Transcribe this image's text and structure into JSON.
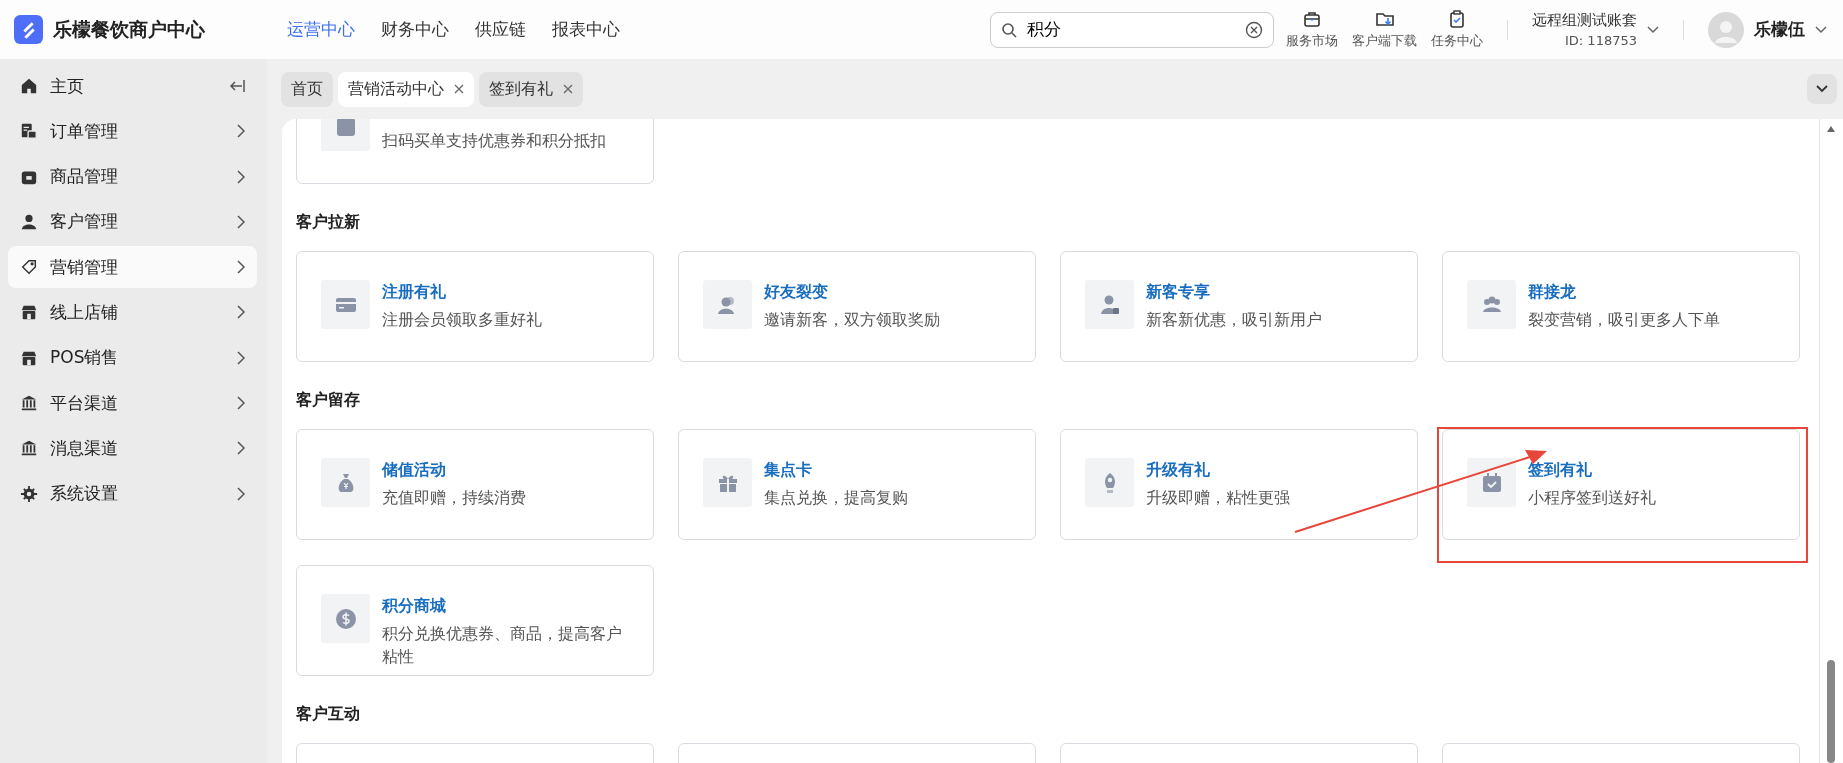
{
  "header": {
    "brand": "乐檬餐饮商户中心",
    "nav": [
      {
        "label": "运营中心",
        "selected": true
      },
      {
        "label": "财务中心",
        "selected": false
      },
      {
        "label": "供应链",
        "selected": false
      },
      {
        "label": "报表中心",
        "selected": false
      }
    ],
    "search": {
      "value": "积分"
    },
    "tools": [
      {
        "label": "服务市场",
        "kind": "bag"
      },
      {
        "label": "客户端下载",
        "kind": "download"
      },
      {
        "label": "任务中心",
        "kind": "task"
      }
    ],
    "account": {
      "name": "远程组测试账套",
      "id": "ID: 118753"
    },
    "user": {
      "name": "乐檬伍"
    }
  },
  "sidebar": {
    "items": [
      {
        "label": "主页",
        "kind": "home",
        "selected": false
      },
      {
        "label": "订单管理",
        "kind": "order",
        "selected": false
      },
      {
        "label": "商品管理",
        "kind": "box",
        "selected": false
      },
      {
        "label": "客户管理",
        "kind": "person",
        "selected": false
      },
      {
        "label": "营销管理",
        "kind": "tag",
        "selected": true
      },
      {
        "label": "线上店铺",
        "kind": "store",
        "selected": false
      },
      {
        "label": "POS销售",
        "kind": "store",
        "selected": false
      },
      {
        "label": "平台渠道",
        "kind": "bank",
        "selected": false
      },
      {
        "label": "消息渠道",
        "kind": "bank",
        "selected": false
      },
      {
        "label": "系统设置",
        "kind": "gear",
        "selected": false
      }
    ]
  },
  "tabs": [
    {
      "label": "首页",
      "closable": false,
      "selected": false
    },
    {
      "label": "营销活动中心",
      "closable": true,
      "selected": true
    },
    {
      "label": "签到有礼",
      "closable": true,
      "selected": false
    }
  ],
  "top_card": {
    "description": "扫码买单支持优惠券和积分抵扣"
  },
  "sections": [
    {
      "title": "客户拉新",
      "cards": [
        {
          "title": "注册有礼",
          "description": "注册会员领取多重好礼",
          "kind": "card",
          "highlighted": false
        },
        {
          "title": "好友裂变",
          "description": "邀请新客，双方领取奖励",
          "kind": "friends",
          "highlighted": false
        },
        {
          "title": "新客专享",
          "description": "新客新优惠，吸引新用户",
          "kind": "newuser",
          "highlighted": false
        },
        {
          "title": "群接龙",
          "description": "裂变营销，吸引更多人下单",
          "kind": "group",
          "highlighted": false
        }
      ]
    },
    {
      "title": "客户留存",
      "cards": [
        {
          "title": "储值活动",
          "description": "充值即赠，持续消费",
          "kind": "moneybag",
          "highlighted": false
        },
        {
          "title": "集点卡",
          "description": "集点兑换，提高复购",
          "kind": "gift",
          "highlighted": false
        },
        {
          "title": "升级有礼",
          "description": "升级即赠，粘性更强",
          "kind": "rocket",
          "highlighted": false
        },
        {
          "title": "签到有礼",
          "description": "小程序签到送好礼",
          "kind": "calendar",
          "highlighted": true
        },
        {
          "title": "积分商城",
          "description": "积分兑换优惠券、商品，提高客户粘性",
          "kind": "coin",
          "highlighted": false
        }
      ]
    },
    {
      "title": "客户互动",
      "cards": [
        {
          "kind": "stub"
        },
        {
          "kind": "stub"
        },
        {
          "kind": "stub"
        },
        {
          "kind": "stub"
        }
      ]
    }
  ]
}
